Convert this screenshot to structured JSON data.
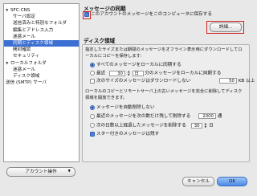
{
  "sidebar": {
    "items": [
      {
        "label": "SFC-CNS",
        "indent": 0,
        "expanded": true
      },
      {
        "label": "サーバ設定",
        "indent": 1
      },
      {
        "label": "送信済みと特別なフォルダ",
        "indent": 1
      },
      {
        "label": "編集とアドレス入力",
        "indent": 1
      },
      {
        "label": "迷惑メール",
        "indent": 1
      },
      {
        "label": "同期とディスク領域",
        "indent": 1,
        "selected": true
      },
      {
        "label": "開封確認",
        "indent": 1
      },
      {
        "label": "セキュリティ",
        "indent": 1
      },
      {
        "label": "ローカルフォルダ",
        "indent": 0,
        "expanded": true
      },
      {
        "label": "迷惑メール",
        "indent": 1
      },
      {
        "label": "ディスク領域",
        "indent": 1
      },
      {
        "label": "送信 (SMTP) サーバ",
        "indent": 0
      }
    ],
    "account_button": "アカウント操作"
  },
  "sync": {
    "heading": "メッセージの同期",
    "keep_local_label": "このアカウントのメッセージをこのコンピュータに保存する",
    "keep_local_checked": true,
    "details_button": "詳細..."
  },
  "disk": {
    "heading": "ディスク領域",
    "desc": "指定したサイズまたは期間のメッセージをオフライン表示用にダウンロードしてローカルにコピーを保存します:",
    "radio_all": "すべてのメッセージをローカルに同期する",
    "radio_recent": "最近",
    "recent_value": "30",
    "recent_unit": "日",
    "recent_suffix": "分のメッセージをローカルに同期する",
    "size_label": "次のサイズのメッセージはダウンロードしない",
    "size_value": "50",
    "size_unit": "KB 以上",
    "cleanup_desc": "ローカルのコピーとリモートサーバ上の古いメッセージを完全に削除してディスク領域を開放できます。",
    "no_delete": "メッセージを自動削除しない",
    "delete_older_label": "最近のメッセージを次の数だけ残して削除する",
    "delete_older_value": "2000",
    "delete_older_unit": "通",
    "delete_days_label": "次の日数以上経過したメッセージを削除する",
    "delete_days_value": "30",
    "delete_days_unit": "日",
    "starred_label": "スター付きのメッセージは残す"
  },
  "footer": {
    "cancel": "キャンセル",
    "ok": "OK"
  }
}
